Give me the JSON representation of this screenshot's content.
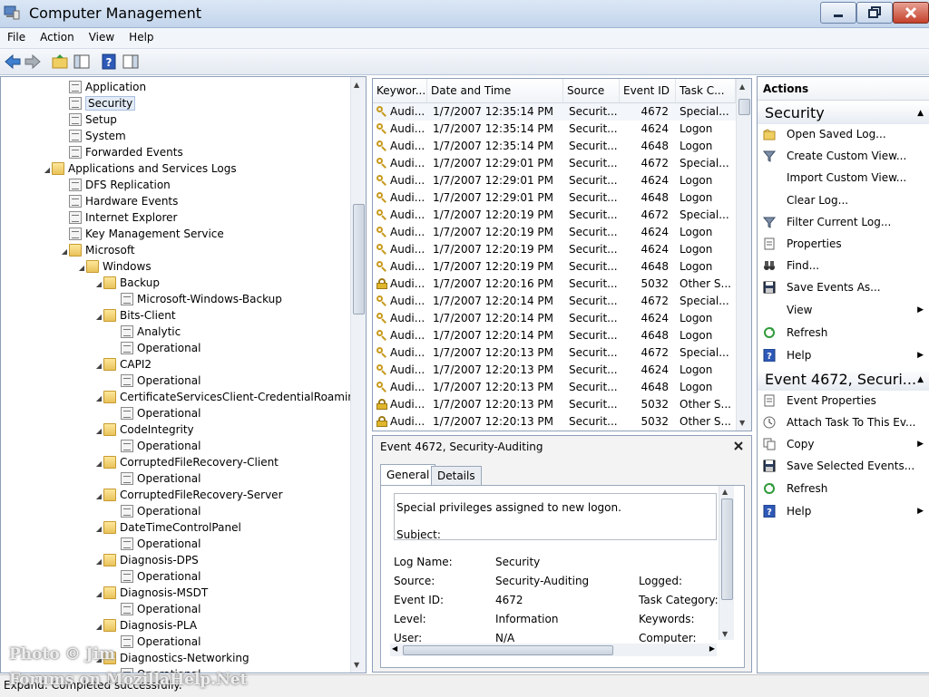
{
  "window": {
    "title": "Computer Management"
  },
  "menu": [
    "File",
    "Action",
    "View",
    "Help"
  ],
  "tree": [
    {
      "label": "Application",
      "depth": 4,
      "icon": "log-icon",
      "arrow": ""
    },
    {
      "label": "Security",
      "depth": 4,
      "icon": "log-icon",
      "arrow": "",
      "selected": true
    },
    {
      "label": "Setup",
      "depth": 4,
      "icon": "log-icon",
      "arrow": ""
    },
    {
      "label": "System",
      "depth": 4,
      "icon": "log-icon",
      "arrow": ""
    },
    {
      "label": "Forwarded Events",
      "depth": 4,
      "icon": "log-icon",
      "arrow": ""
    },
    {
      "label": "Applications and Services Logs",
      "depth": 3,
      "icon": "folder-icon",
      "arrow": "◢"
    },
    {
      "label": "DFS Replication",
      "depth": 4,
      "icon": "log-icon",
      "arrow": ""
    },
    {
      "label": "Hardware Events",
      "depth": 4,
      "icon": "log-icon",
      "arrow": ""
    },
    {
      "label": "Internet Explorer",
      "depth": 4,
      "icon": "log-icon",
      "arrow": ""
    },
    {
      "label": "Key Management Service",
      "depth": 4,
      "icon": "log-icon",
      "arrow": ""
    },
    {
      "label": "Microsoft",
      "depth": 4,
      "icon": "folder-icon",
      "arrow": "◢"
    },
    {
      "label": "Windows",
      "depth": 5,
      "icon": "folder-icon",
      "arrow": "◢"
    },
    {
      "label": "Backup",
      "depth": 6,
      "icon": "folder-icon",
      "arrow": "◢"
    },
    {
      "label": "Microsoft-Windows-Backup",
      "depth": 7,
      "icon": "log-icon",
      "arrow": ""
    },
    {
      "label": "Bits-Client",
      "depth": 6,
      "icon": "folder-icon",
      "arrow": "◢"
    },
    {
      "label": "Analytic",
      "depth": 7,
      "icon": "log-icon",
      "arrow": ""
    },
    {
      "label": "Operational",
      "depth": 7,
      "icon": "log-icon",
      "arrow": ""
    },
    {
      "label": "CAPI2",
      "depth": 6,
      "icon": "folder-icon",
      "arrow": "◢"
    },
    {
      "label": "Operational",
      "depth": 7,
      "icon": "log-icon",
      "arrow": ""
    },
    {
      "label": "CertificateServicesClient-CredentialRoaming",
      "depth": 6,
      "icon": "folder-icon",
      "arrow": "◢"
    },
    {
      "label": "Operational",
      "depth": 7,
      "icon": "log-icon",
      "arrow": ""
    },
    {
      "label": "CodeIntegrity",
      "depth": 6,
      "icon": "folder-icon",
      "arrow": "◢"
    },
    {
      "label": "Operational",
      "depth": 7,
      "icon": "log-icon",
      "arrow": ""
    },
    {
      "label": "CorruptedFileRecovery-Client",
      "depth": 6,
      "icon": "folder-icon",
      "arrow": "◢"
    },
    {
      "label": "Operational",
      "depth": 7,
      "icon": "log-icon",
      "arrow": ""
    },
    {
      "label": "CorruptedFileRecovery-Server",
      "depth": 6,
      "icon": "folder-icon",
      "arrow": "◢"
    },
    {
      "label": "Operational",
      "depth": 7,
      "icon": "log-icon",
      "arrow": ""
    },
    {
      "label": "DateTimeControlPanel",
      "depth": 6,
      "icon": "folder-icon",
      "arrow": "◢"
    },
    {
      "label": "Operational",
      "depth": 7,
      "icon": "log-icon",
      "arrow": ""
    },
    {
      "label": "Diagnosis-DPS",
      "depth": 6,
      "icon": "folder-icon",
      "arrow": "◢"
    },
    {
      "label": "Operational",
      "depth": 7,
      "icon": "log-icon",
      "arrow": ""
    },
    {
      "label": "Diagnosis-MSDT",
      "depth": 6,
      "icon": "folder-icon",
      "arrow": "◢"
    },
    {
      "label": "Operational",
      "depth": 7,
      "icon": "log-icon",
      "arrow": ""
    },
    {
      "label": "Diagnosis-PLA",
      "depth": 6,
      "icon": "folder-icon",
      "arrow": "◢"
    },
    {
      "label": "Operational",
      "depth": 7,
      "icon": "log-icon",
      "arrow": ""
    },
    {
      "label": "Diagnostics-Networking",
      "depth": 6,
      "icon": "folder-icon",
      "arrow": "◢"
    },
    {
      "label": "Operational",
      "depth": 7,
      "icon": "log-icon",
      "arrow": ""
    }
  ],
  "events": {
    "columns": [
      "Keywor...",
      "Date and Time",
      "Source",
      "Event ID",
      "Task C..."
    ],
    "rows": [
      {
        "icon": "key-icon",
        "keyword": "Audi...",
        "datetime": "1/7/2007 12:35:14 PM",
        "source": "Securit...",
        "event_id": "4672",
        "task": "Special..."
      },
      {
        "icon": "key-icon",
        "keyword": "Audi...",
        "datetime": "1/7/2007 12:35:14 PM",
        "source": "Securit...",
        "event_id": "4624",
        "task": "Logon"
      },
      {
        "icon": "key-icon",
        "keyword": "Audi...",
        "datetime": "1/7/2007 12:35:14 PM",
        "source": "Securit...",
        "event_id": "4648",
        "task": "Logon"
      },
      {
        "icon": "key-icon",
        "keyword": "Audi...",
        "datetime": "1/7/2007 12:29:01 PM",
        "source": "Securit...",
        "event_id": "4672",
        "task": "Special..."
      },
      {
        "icon": "key-icon",
        "keyword": "Audi...",
        "datetime": "1/7/2007 12:29:01 PM",
        "source": "Securit...",
        "event_id": "4624",
        "task": "Logon"
      },
      {
        "icon": "key-icon",
        "keyword": "Audi...",
        "datetime": "1/7/2007 12:29:01 PM",
        "source": "Securit...",
        "event_id": "4648",
        "task": "Logon"
      },
      {
        "icon": "key-icon",
        "keyword": "Audi...",
        "datetime": "1/7/2007 12:20:19 PM",
        "source": "Securit...",
        "event_id": "4672",
        "task": "Special..."
      },
      {
        "icon": "key-icon",
        "keyword": "Audi...",
        "datetime": "1/7/2007 12:20:19 PM",
        "source": "Securit...",
        "event_id": "4624",
        "task": "Logon"
      },
      {
        "icon": "key-icon",
        "keyword": "Audi...",
        "datetime": "1/7/2007 12:20:19 PM",
        "source": "Securit...",
        "event_id": "4624",
        "task": "Logon"
      },
      {
        "icon": "key-icon",
        "keyword": "Audi...",
        "datetime": "1/7/2007 12:20:19 PM",
        "source": "Securit...",
        "event_id": "4648",
        "task": "Logon"
      },
      {
        "icon": "lock-icon",
        "keyword": "Audi...",
        "datetime": "1/7/2007 12:20:16 PM",
        "source": "Securit...",
        "event_id": "5032",
        "task": "Other S..."
      },
      {
        "icon": "key-icon",
        "keyword": "Audi...",
        "datetime": "1/7/2007 12:20:14 PM",
        "source": "Securit...",
        "event_id": "4672",
        "task": "Special..."
      },
      {
        "icon": "key-icon",
        "keyword": "Audi...",
        "datetime": "1/7/2007 12:20:14 PM",
        "source": "Securit...",
        "event_id": "4624",
        "task": "Logon"
      },
      {
        "icon": "key-icon",
        "keyword": "Audi...",
        "datetime": "1/7/2007 12:20:14 PM",
        "source": "Securit...",
        "event_id": "4648",
        "task": "Logon"
      },
      {
        "icon": "key-icon",
        "keyword": "Audi...",
        "datetime": "1/7/2007 12:20:13 PM",
        "source": "Securit...",
        "event_id": "4672",
        "task": "Special..."
      },
      {
        "icon": "key-icon",
        "keyword": "Audi...",
        "datetime": "1/7/2007 12:20:13 PM",
        "source": "Securit...",
        "event_id": "4624",
        "task": "Logon"
      },
      {
        "icon": "key-icon",
        "keyword": "Audi...",
        "datetime": "1/7/2007 12:20:13 PM",
        "source": "Securit...",
        "event_id": "4648",
        "task": "Logon"
      },
      {
        "icon": "lock-icon",
        "keyword": "Audi...",
        "datetime": "1/7/2007 12:20:13 PM",
        "source": "Securit...",
        "event_id": "5032",
        "task": "Other S..."
      },
      {
        "icon": "lock-icon",
        "keyword": "Audi...",
        "datetime": "1/7/2007 12:20:13 PM",
        "source": "Securit...",
        "event_id": "5032",
        "task": "Other S..."
      }
    ]
  },
  "detail": {
    "title": "Event 4672, Security-Auditing",
    "tabs": [
      "General",
      "Details"
    ],
    "description": "Special privileges assigned to new logon.",
    "subject": "Subject:",
    "fields": {
      "log_name_label": "Log Name:",
      "log_name": "Security",
      "source_label": "Source:",
      "source": "Security-Auditing",
      "logged_label": "Logged:",
      "event_id_label": "Event ID:",
      "event_id": "4672",
      "task_label": "Task Category:",
      "level_label": "Level:",
      "level": "Information",
      "keywords_label": "Keywords:",
      "user_label": "User:",
      "user": "N/A",
      "computer_label": "Computer:"
    }
  },
  "actions": {
    "header": "Actions",
    "section1": "Security",
    "section1_items": [
      {
        "label": "Open Saved Log...",
        "icon": "open-folder-icon",
        "sub": false
      },
      {
        "label": "Create Custom View...",
        "icon": "filter-icon",
        "sub": false
      },
      {
        "label": "Import Custom View...",
        "icon": "",
        "sub": false
      },
      {
        "label": "Clear Log...",
        "icon": "",
        "sub": false
      },
      {
        "label": "Filter Current Log...",
        "icon": "filter-icon",
        "sub": false
      },
      {
        "label": "Properties",
        "icon": "properties-icon",
        "sub": false
      },
      {
        "label": "Find...",
        "icon": "binoculars-icon",
        "sub": false
      },
      {
        "label": "Save Events As...",
        "icon": "save-icon",
        "sub": false
      },
      {
        "label": "View",
        "icon": "",
        "sub": true
      },
      {
        "label": "Refresh",
        "icon": "refresh-icon",
        "sub": false
      },
      {
        "label": "Help",
        "icon": "help-icon",
        "sub": true
      }
    ],
    "section2": "Event 4672, Securi...",
    "section2_items": [
      {
        "label": "Event Properties",
        "icon": "properties-icon",
        "sub": false
      },
      {
        "label": "Attach Task To This Ev...",
        "icon": "task-icon",
        "sub": false
      },
      {
        "label": "Copy",
        "icon": "copy-icon",
        "sub": true
      },
      {
        "label": "Save Selected Events...",
        "icon": "save-icon",
        "sub": false
      },
      {
        "label": "Refresh",
        "icon": "refresh-icon",
        "sub": false
      },
      {
        "label": "Help",
        "icon": "help-icon",
        "sub": true
      }
    ]
  },
  "status": {
    "text": "Expand:  Completed successfully."
  },
  "watermark": {
    "line1": "Photo © Jim",
    "line2": "Forums on MozillaHelp.Net"
  }
}
